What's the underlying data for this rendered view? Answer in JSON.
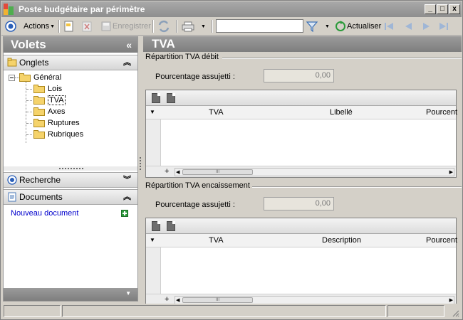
{
  "window": {
    "title": "Poste budgétaire par périmètre",
    "controls": {
      "minimize": "_",
      "maximize": "□",
      "close": "x"
    }
  },
  "toolbar": {
    "actions_label": "Actions",
    "save_label": "Enregistrer",
    "refresh_label": "Actualiser",
    "filter_value": ""
  },
  "left_panel": {
    "title": "Volets",
    "onglets": {
      "label": "Onglets",
      "tree": {
        "root": "Général",
        "children": [
          "Lois",
          "TVA",
          "Axes",
          "Ruptures",
          "Rubriques"
        ],
        "selected": "TVA"
      }
    },
    "recherche": {
      "label": "Recherche"
    },
    "documents": {
      "label": "Documents",
      "new_link": "Nouveau document"
    }
  },
  "right_panel": {
    "title": "TVA",
    "debit": {
      "group_title": "Répartition TVA débit",
      "field_label": "Pourcentage assujetti :",
      "field_value": "0,00",
      "columns": [
        "TVA",
        "Libellé",
        "Pourcent"
      ]
    },
    "encaissement": {
      "group_title": "Répartition TVA encaissement",
      "field_label": "Pourcentage assujetti :",
      "field_value": "0,00",
      "columns": [
        "TVA",
        "Description",
        "Pourcent"
      ]
    },
    "grid_add": "+",
    "scroll_grip": "III"
  },
  "colors": {
    "header_gray": "#8e8e8e",
    "link_blue": "#0000cc",
    "accent_green": "#2a9a3a"
  }
}
